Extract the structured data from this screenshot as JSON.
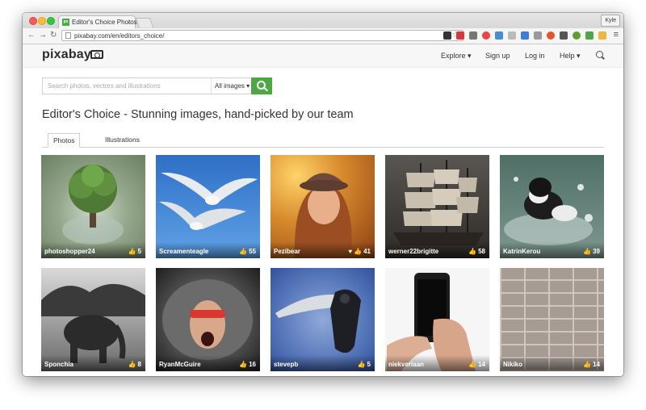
{
  "browser": {
    "tab_title": "Editor's Choice Photos",
    "tab_favicon": "px",
    "tab_close": "×",
    "profile": "Kyle",
    "url": "pixabay.com/en/editors_choice/"
  },
  "site": {
    "logo": "pixabay",
    "nav": {
      "explore": "Explore ▾",
      "signup": "Sign up",
      "login": "Log in",
      "help": "Help ▾"
    }
  },
  "search": {
    "placeholder": "Search photos, vectors and illustrations",
    "filter": "All images ▾"
  },
  "page": {
    "title": "Editor's Choice - Stunning images, hand-picked by our team",
    "tabs": [
      "Photos",
      "Illustrations"
    ]
  },
  "photos": [
    {
      "author": "photoshopper24",
      "likes": "5"
    },
    {
      "author": "Screamenteagle",
      "likes": "55"
    },
    {
      "author": "Pezibear",
      "likes": "41"
    },
    {
      "author": "werner22brigitte",
      "likes": "58"
    },
    {
      "author": "KatrinKerou",
      "likes": "39"
    },
    {
      "author": "Sponchia",
      "likes": "8"
    },
    {
      "author": "RyanMcGuire",
      "likes": "16"
    },
    {
      "author": "stevepb",
      "likes": "5"
    },
    {
      "author": "niekverlaan",
      "likes": "14"
    },
    {
      "author": "Nikiko",
      "likes": "14"
    }
  ],
  "colors": {
    "accent": "#4ca845"
  }
}
